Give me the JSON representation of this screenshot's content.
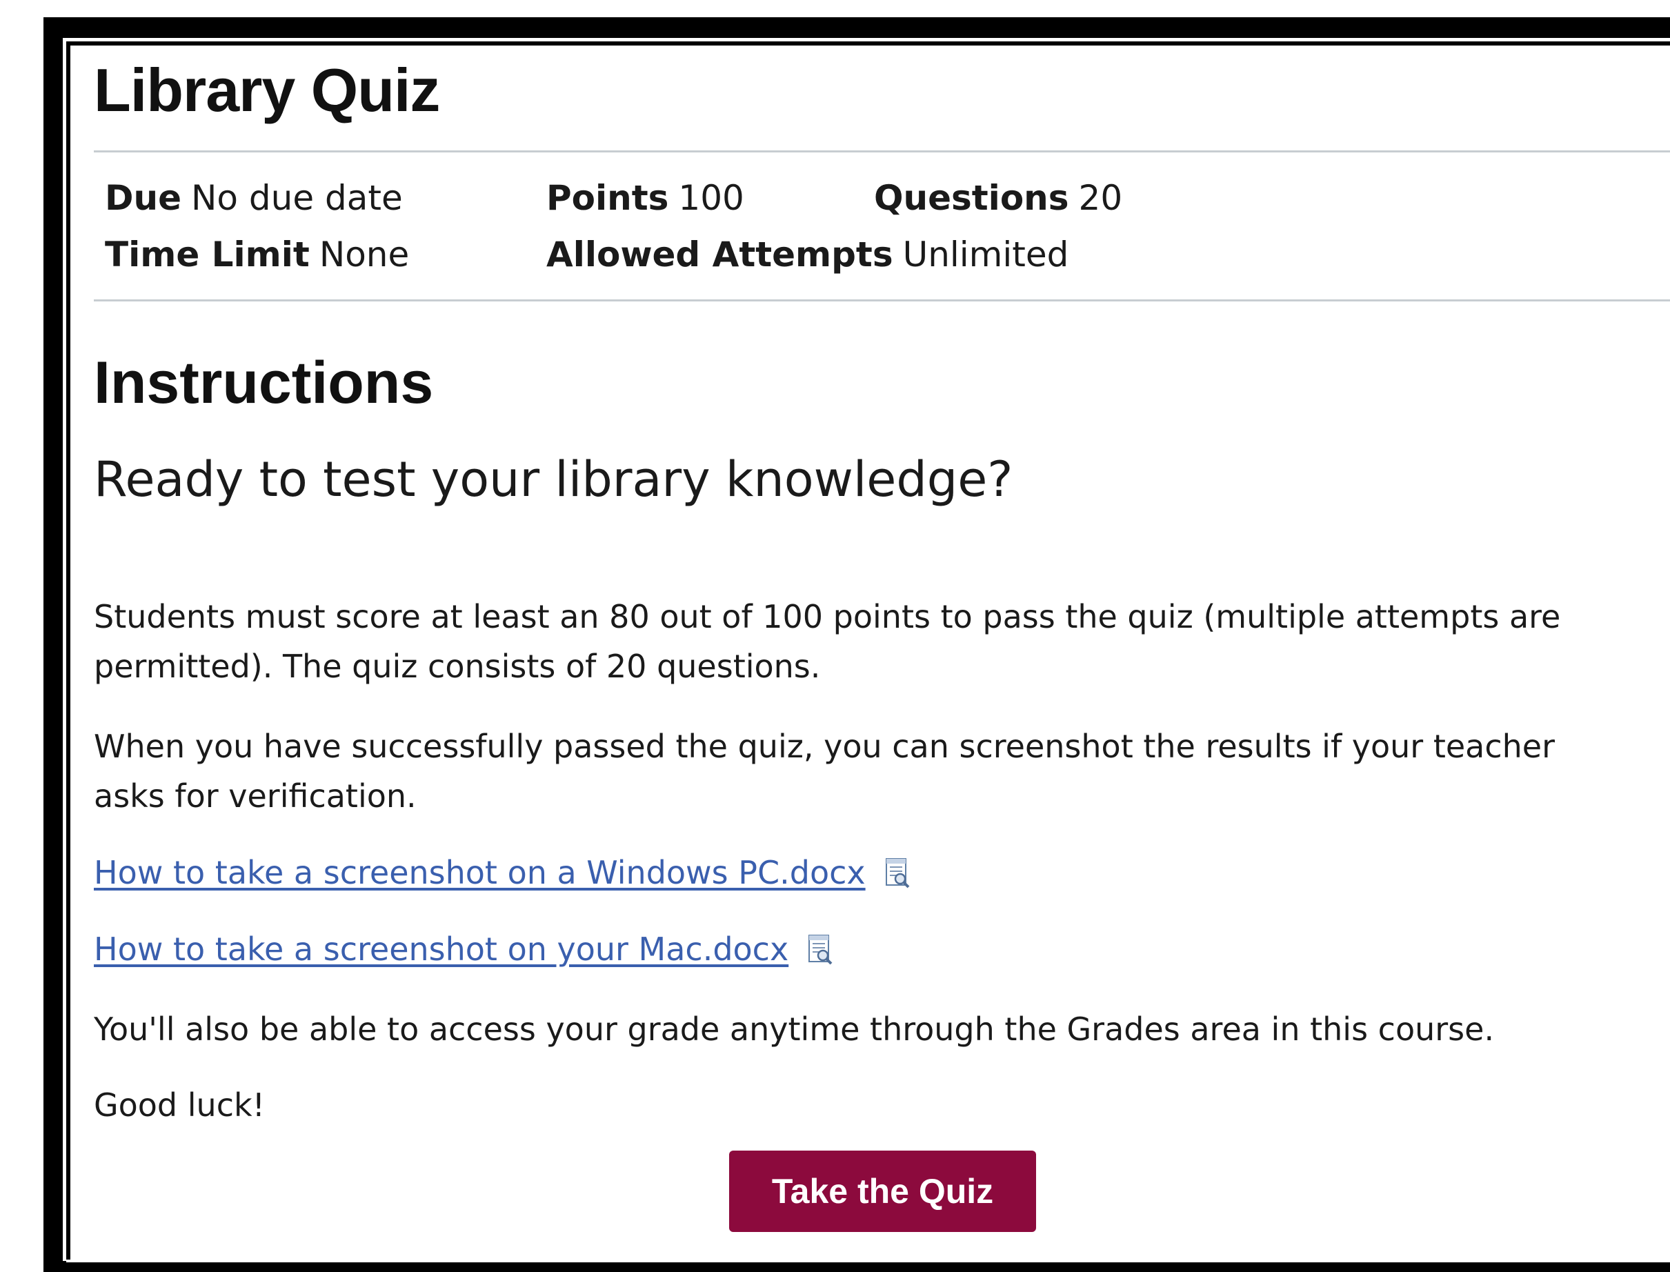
{
  "page": {
    "title": "Library Quiz"
  },
  "details": {
    "due": {
      "label": "Due",
      "value": "No due date"
    },
    "points": {
      "label": "Points",
      "value": "100"
    },
    "questions": {
      "label": "Questions",
      "value": "20"
    },
    "time_limit": {
      "label": "Time Limit",
      "value": "None"
    },
    "allowed_attempts": {
      "label": "Allowed Attempts",
      "value": "Unlimited"
    }
  },
  "instructions": {
    "heading": "Instructions",
    "subheading": "Ready to test your library knowledge?",
    "paragraph_1_line_1": "Students must score at least an 80 out of 100 points to pass the quiz (multiple attempts are",
    "paragraph_1_line_2": "permitted).  The quiz consists of 20 questions.",
    "paragraph_2_line_1": "When you have successfully passed the quiz, you can screenshot the results if your teacher",
    "paragraph_2_line_2": "asks for verification.",
    "links": [
      {
        "label": "How to take a screenshot on a Windows PC.docx",
        "icon": "document-preview-icon"
      },
      {
        "label": "How to take a screenshot on your Mac.docx",
        "icon": "document-preview-icon"
      }
    ],
    "paragraph_3": "You'll also be able to access your grade anytime through the Grades area in this course.",
    "paragraph_4": "Good luck!"
  },
  "actions": {
    "take_quiz_label": "Take the Quiz"
  },
  "colors": {
    "button_background": "#8c0a3d",
    "link": "#3a5fae",
    "divider": "#c7cdd1",
    "frame": "#000000"
  }
}
